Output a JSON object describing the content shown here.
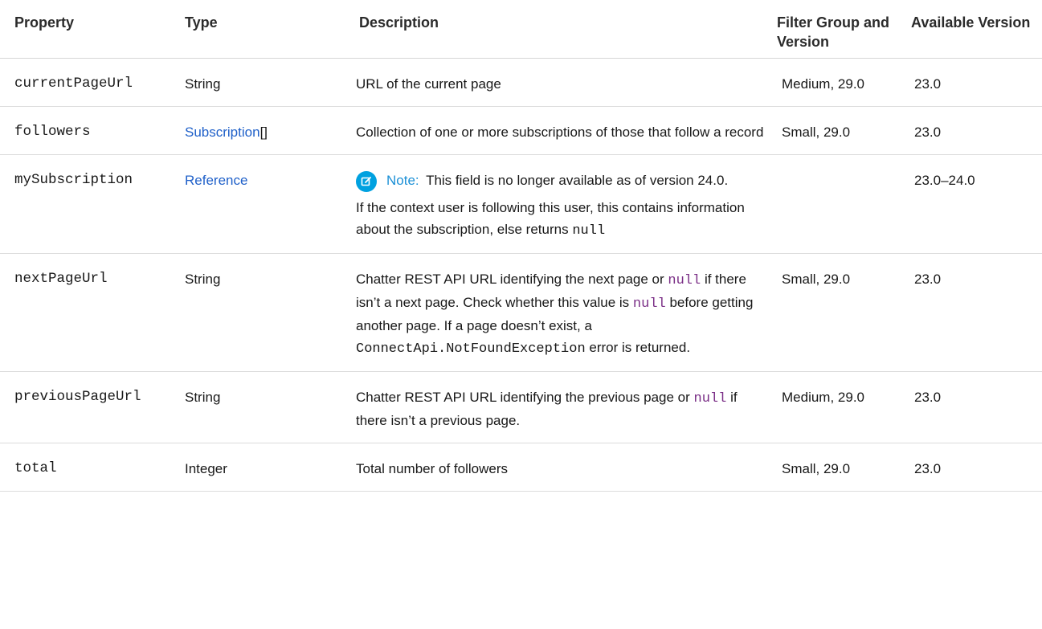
{
  "headers": {
    "property": "Property",
    "type": "Type",
    "description": "Description",
    "filter_group": "Filter Group and Version",
    "available_version": "Available Version"
  },
  "rows": [
    {
      "property": "currentPageUrl",
      "type": "String",
      "description": "URL of the current page",
      "filter_group": "Medium, 29.0",
      "available_version": "23.0"
    },
    {
      "property": "followers",
      "type": "Subscription",
      "type_suffix": "[]",
      "description": "Collection of one or more subscriptions of those that follow a record",
      "filter_group": "Small, 29.0",
      "available_version": "23.0"
    },
    {
      "property": "mySubscription",
      "type": "Reference",
      "note_label": "Note:",
      "note_text": "This field is no longer available as of version 24.0.",
      "description": "If the context user is following this user, this contains information about the subscription, else returns",
      "description_code": "null",
      "filter_group": "",
      "available_version": "23.0–24.0"
    },
    {
      "property": "nextPageUrl",
      "type": "String",
      "desc_part1": "Chatter REST API URL identifying the next page or",
      "null1": "null",
      "desc_part2": "if there isn’t a next page. Check whether this value is",
      "null2": "null",
      "desc_part3": "before getting another page. If a page doesn’t exist, a",
      "exception": "ConnectApi.NotFoundException",
      "desc_part4": "error is returned.",
      "filter_group": "Small, 29.0",
      "available_version": "23.0"
    },
    {
      "property": "previousPageUrl",
      "type": "String",
      "desc_part1": "Chatter REST API URL identifying the previous page or",
      "null1": "null",
      "desc_part2": "if there isn’t a previous page.",
      "filter_group": "Medium, 29.0",
      "available_version": "23.0"
    },
    {
      "property": "total",
      "type": "Integer",
      "description": "Total number of followers",
      "filter_group": "Small, 29.0",
      "available_version": "23.0"
    }
  ],
  "icons": {
    "note": "edit-note-icon"
  },
  "colors": {
    "link": "#1f60c9",
    "code": "#7a2e86",
    "note_icon": "#00a1e0",
    "note_label": "#1a8fd6"
  }
}
